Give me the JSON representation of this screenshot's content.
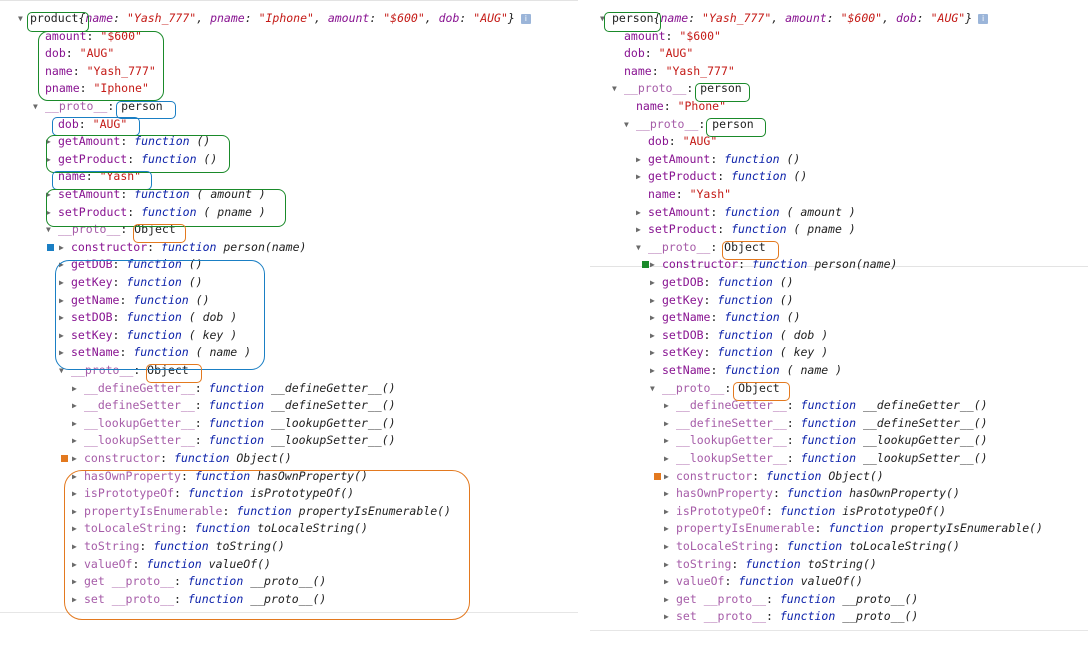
{
  "left": {
    "header": {
      "name": "product",
      "summary": [
        [
          "name",
          "\"Yash_777\""
        ],
        [
          "pname",
          "\"Iphone\""
        ],
        [
          "amount",
          "\"$600\""
        ],
        [
          "dob",
          "\"AUG\""
        ]
      ]
    },
    "props": [
      {
        "k": "amount",
        "v": "\"$600\""
      },
      {
        "k": "dob",
        "v": "\"AUG\""
      },
      {
        "k": "name",
        "v": "\"Yash_777\""
      },
      {
        "k": "pname",
        "v": "\"Iphone\""
      }
    ],
    "proto1": {
      "label": "__proto__",
      "type": "person"
    },
    "proto1_items": [
      {
        "k": "dob",
        "v": "\"AUG\""
      },
      {
        "k": "getAmount",
        "fn": "function",
        "sig": "()"
      },
      {
        "k": "getProduct",
        "fn": "function",
        "sig": "()"
      },
      {
        "k": "name",
        "v": "\"Yash\""
      },
      {
        "k": "setAmount",
        "fn": "function",
        "sig": "( amount )"
      },
      {
        "k": "setProduct",
        "fn": "function",
        "sig": "( pname )"
      }
    ],
    "proto2": {
      "label": "__proto__",
      "type": "Object"
    },
    "proto2_items": [
      {
        "k": "constructor",
        "fn": "function",
        "sig": "person(name)"
      },
      {
        "k": "getDOB",
        "fn": "function",
        "sig": "()"
      },
      {
        "k": "getKey",
        "fn": "function",
        "sig": "()"
      },
      {
        "k": "getName",
        "fn": "function",
        "sig": "()"
      },
      {
        "k": "setDOB",
        "fn": "function",
        "sig": "( dob )"
      },
      {
        "k": "setKey",
        "fn": "function",
        "sig": "( key )"
      },
      {
        "k": "setName",
        "fn": "function",
        "sig": "( name )"
      }
    ],
    "proto3": {
      "label": "__proto__",
      "type": "Object"
    },
    "proto3_items": [
      {
        "k": "__defineGetter__",
        "fn": "function",
        "sig": "__defineGetter__()"
      },
      {
        "k": "__defineSetter__",
        "fn": "function",
        "sig": "__defineSetter__()"
      },
      {
        "k": "__lookupGetter__",
        "fn": "function",
        "sig": "__lookupGetter__()"
      },
      {
        "k": "__lookupSetter__",
        "fn": "function",
        "sig": "__lookupSetter__()"
      },
      {
        "k": "constructor",
        "fn": "function",
        "sig": "Object()"
      },
      {
        "k": "hasOwnProperty",
        "fn": "function",
        "sig": "hasOwnProperty()"
      },
      {
        "k": "isPrototypeOf",
        "fn": "function",
        "sig": "isPrototypeOf()"
      },
      {
        "k": "propertyIsEnumerable",
        "fn": "function",
        "sig": "propertyIsEnumerable()"
      },
      {
        "k": "toLocaleString",
        "fn": "function",
        "sig": "toLocaleString()"
      },
      {
        "k": "toString",
        "fn": "function",
        "sig": "toString()"
      },
      {
        "k": "valueOf",
        "fn": "function",
        "sig": "valueOf()"
      },
      {
        "k": "get __proto__",
        "fn": "function",
        "sig": "__proto__()"
      },
      {
        "k": "set __proto__",
        "fn": "function",
        "sig": "__proto__()"
      }
    ]
  },
  "right": {
    "header": {
      "name": "person",
      "summary": [
        [
          "name",
          "\"Yash_777\""
        ],
        [
          "amount",
          "\"$600\""
        ],
        [
          "dob",
          "\"AUG\""
        ]
      ]
    },
    "props": [
      {
        "k": "amount",
        "v": "\"$600\""
      },
      {
        "k": "dob",
        "v": "\"AUG\""
      },
      {
        "k": "name",
        "v": "\"Yash_777\""
      }
    ],
    "proto1": {
      "label": "__proto__",
      "type": "person"
    },
    "proto1_items": [
      {
        "k": "name",
        "v": "\"Phone\""
      }
    ],
    "proto2": {
      "label": "__proto__",
      "type": "person"
    },
    "proto2_items": [
      {
        "k": "dob",
        "v": "\"AUG\""
      },
      {
        "k": "getAmount",
        "fn": "function",
        "sig": "()"
      },
      {
        "k": "getProduct",
        "fn": "function",
        "sig": "()"
      },
      {
        "k": "name",
        "v": "\"Yash\""
      },
      {
        "k": "setAmount",
        "fn": "function",
        "sig": "( amount )"
      },
      {
        "k": "setProduct",
        "fn": "function",
        "sig": "( pname )"
      }
    ],
    "proto3": {
      "label": "__proto__",
      "type": "Object"
    },
    "proto3_items": [
      {
        "k": "constructor",
        "fn": "function",
        "sig": "person(name)"
      },
      {
        "k": "getDOB",
        "fn": "function",
        "sig": "()"
      },
      {
        "k": "getKey",
        "fn": "function",
        "sig": "()"
      },
      {
        "k": "getName",
        "fn": "function",
        "sig": "()"
      },
      {
        "k": "setDOB",
        "fn": "function",
        "sig": "( dob )"
      },
      {
        "k": "setKey",
        "fn": "function",
        "sig": "( key )"
      },
      {
        "k": "setName",
        "fn": "function",
        "sig": "( name )"
      }
    ],
    "proto4": {
      "label": "__proto__",
      "type": "Object"
    },
    "proto4_items": [
      {
        "k": "__defineGetter__",
        "fn": "function",
        "sig": "__defineGetter__()"
      },
      {
        "k": "__defineSetter__",
        "fn": "function",
        "sig": "__defineSetter__()"
      },
      {
        "k": "__lookupGetter__",
        "fn": "function",
        "sig": "__lookupGetter__()"
      },
      {
        "k": "__lookupSetter__",
        "fn": "function",
        "sig": "__lookupSetter__()"
      },
      {
        "k": "constructor",
        "fn": "function",
        "sig": "Object()"
      },
      {
        "k": "hasOwnProperty",
        "fn": "function",
        "sig": "hasOwnProperty()"
      },
      {
        "k": "isPrototypeOf",
        "fn": "function",
        "sig": "isPrototypeOf()"
      },
      {
        "k": "propertyIsEnumerable",
        "fn": "function",
        "sig": "propertyIsEnumerable()"
      },
      {
        "k": "toLocaleString",
        "fn": "function",
        "sig": "toLocaleString()"
      },
      {
        "k": "toString",
        "fn": "function",
        "sig": "toString()"
      },
      {
        "k": "valueOf",
        "fn": "function",
        "sig": "valueOf()"
      },
      {
        "k": "get __proto__",
        "fn": "function",
        "sig": "__proto__()"
      },
      {
        "k": "set __proto__",
        "fn": "function",
        "sig": "__proto__()"
      }
    ]
  },
  "icons": {
    "expanded": "triangle-down-icon",
    "collapsed": "triangle-right-icon",
    "info": "info-icon"
  },
  "colors": {
    "green": "#1a8a2a",
    "blue": "#1a7fc4",
    "orange": "#e3791f",
    "key": "#881391",
    "string": "#c41a16",
    "keyword": "#0d22aa"
  }
}
